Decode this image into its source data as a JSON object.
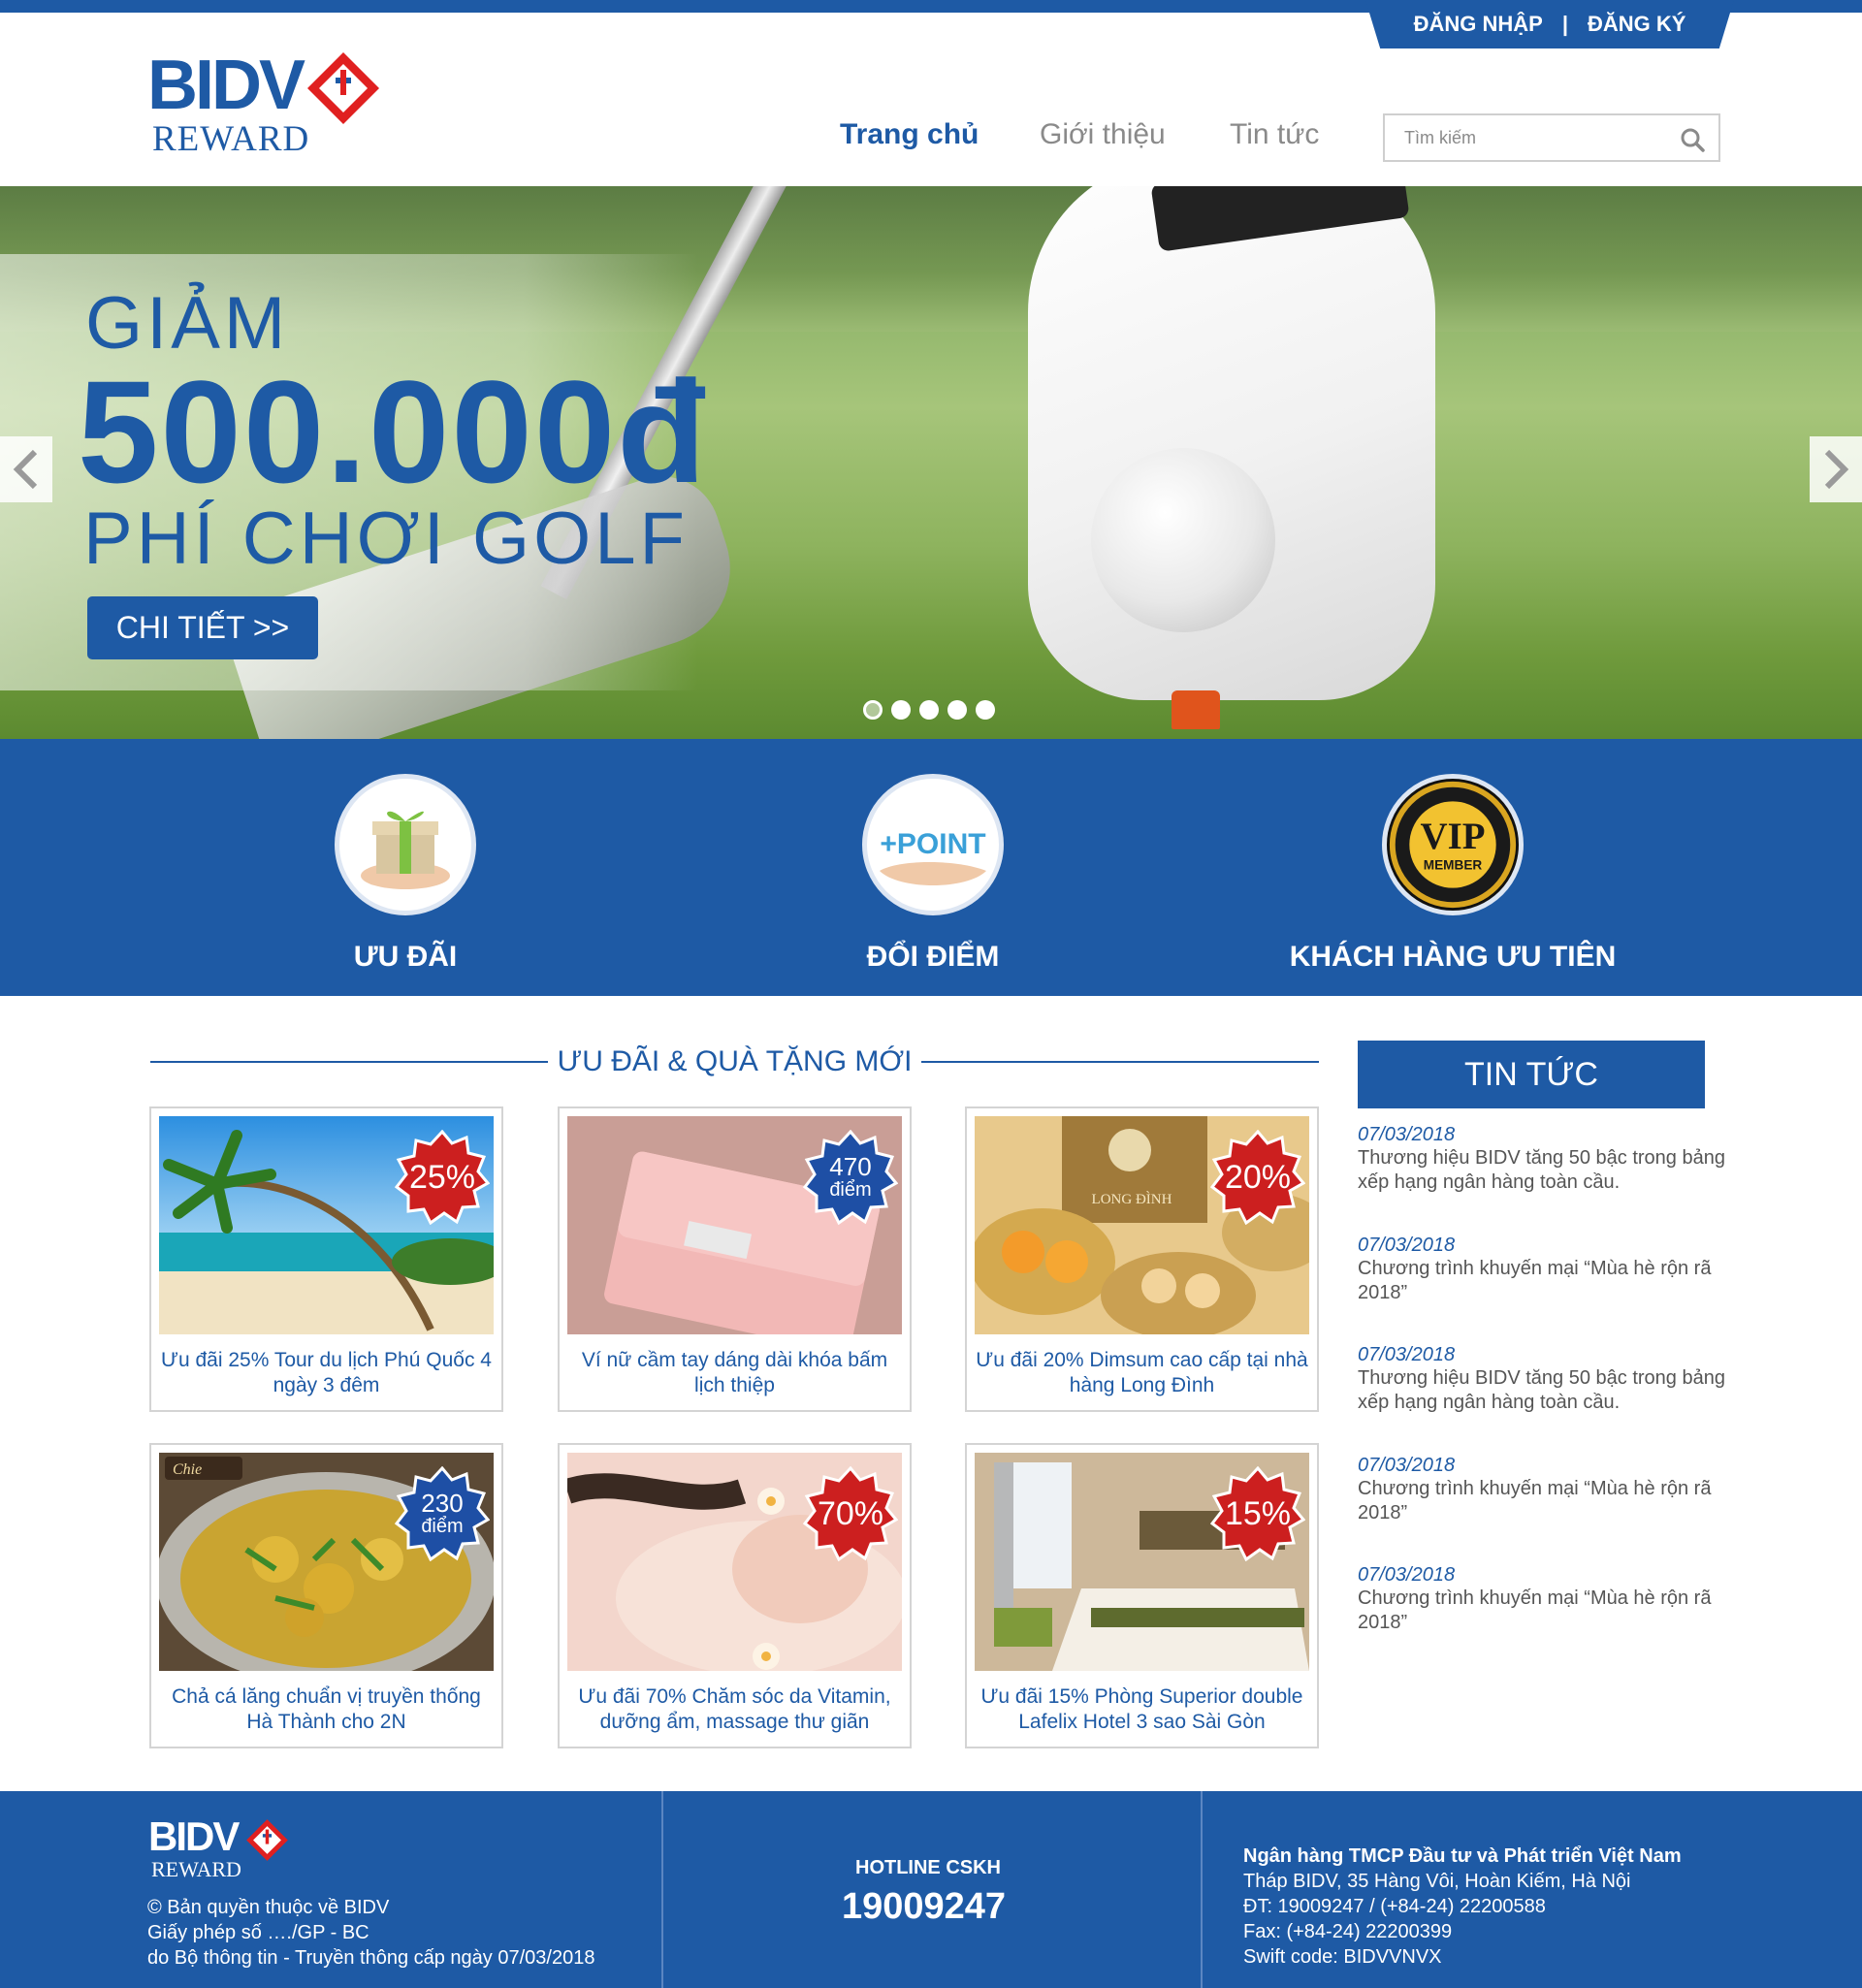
{
  "header": {
    "login": "ĐĂNG NHẬP",
    "separator": "|",
    "register": "ĐĂNG KÝ",
    "logo_text": "BIDV",
    "logo_sub": "REWARD",
    "nav": [
      "Trang chủ",
      "Giới thiệu",
      "Tin tức"
    ],
    "search_placeholder": "Tìm kiếm"
  },
  "banner": {
    "line1": "GIẢM",
    "line2": "500.000đ",
    "line3": "PHÍ CHƠI GOLF",
    "button": "CHI TIẾT >>",
    "slides": 5,
    "active_slide": 1
  },
  "features": [
    {
      "label": "ƯU ĐÃI",
      "icon": "gift-icon"
    },
    {
      "label": "ĐỔI ĐIỂM",
      "icon": "point-icon"
    },
    {
      "label": "KHÁCH HÀNG ƯU TIÊN",
      "icon": "vip-member-icon"
    }
  ],
  "vip": {
    "big": "VIP",
    "small": "MEMBER"
  },
  "point_art": "+POINT",
  "offers": {
    "title": "ƯU ĐÃI & QUÀ TẶNG MỚI",
    "items": [
      {
        "badge": "25%",
        "badge_sub": "",
        "color": "#cc1f1f",
        "caption": "Ưu đãi 25% Tour du lịch Phú Quốc 4 ngày 3 đêm"
      },
      {
        "badge": "470",
        "badge_sub": "điểm",
        "color": "#1e4fa5",
        "caption": "Ví nữ cầm tay dáng dài khóa bấm lịch thiệp"
      },
      {
        "badge": "20%",
        "badge_sub": "",
        "color": "#cc1f1f",
        "caption": "Ưu đãi 20% Dimsum cao cấp tại nhà hàng Long Đình"
      },
      {
        "badge": "230",
        "badge_sub": "điểm",
        "color": "#1e4fa5",
        "caption": "Chả cá lăng chuẩn vị truyền thống Hà Thành cho 2N"
      },
      {
        "badge": "70%",
        "badge_sub": "",
        "color": "#cc1f1f",
        "caption": "Ưu đãi 70% Chăm sóc da Vitamin, dưỡng ẩm, massage thư giãn"
      },
      {
        "badge": "15%",
        "badge_sub": "",
        "color": "#cc1f1f",
        "caption": "Ưu đãi 15% Phòng Superior double Lafelix Hotel 3 sao Sài Gòn"
      }
    ]
  },
  "image_texts": {
    "long_dinh": "LONG ĐÌNH",
    "chie": "Chie"
  },
  "news": {
    "title": "TIN TỨC",
    "items": [
      {
        "date": "07/03/2018",
        "text": "Thương hiệu BIDV tăng 50 bậc trong bảng xếp hạng ngân hàng toàn cầu."
      },
      {
        "date": "07/03/2018",
        "text": "Chương trình khuyến mại “Mùa hè rộn rã 2018”"
      },
      {
        "date": "07/03/2018",
        "text": "Thương hiệu BIDV tăng 50 bậc trong bảng xếp hạng ngân hàng toàn cầu."
      },
      {
        "date": "07/03/2018",
        "text": "Chương trình khuyến mại “Mùa hè rộn rã 2018”"
      },
      {
        "date": "07/03/2018",
        "text": "Chương trình khuyến mại “Mùa hè rộn rã 2018”"
      }
    ]
  },
  "footer": {
    "logo_text": "BIDV",
    "logo_sub": "REWARD",
    "copyright": "© Bản quyền thuộc về BIDV",
    "license": "Giấy phép số …./GP - BC",
    "issuer": "do Bộ thông tin - Truyền thông cấp ngày 07/03/2018",
    "hotline_label": "HOTLINE CSKH",
    "hotline": "19009247",
    "bank_name": "Ngân hàng TMCP Đầu tư và Phát triển Việt Nam",
    "address": "Tháp BIDV, 35 Hàng Vôi, Hoàn Kiếm, Hà Nội",
    "phone": "ĐT: 19009247 / (+84-24) 22200588",
    "fax": "Fax: (+84-24) 22200399",
    "swift": "Swift code: BIDVVNVX"
  },
  "colors": {
    "brand_blue": "#1e5aa5",
    "badge_red": "#cc1f1f",
    "logo_red": "#e02020"
  }
}
